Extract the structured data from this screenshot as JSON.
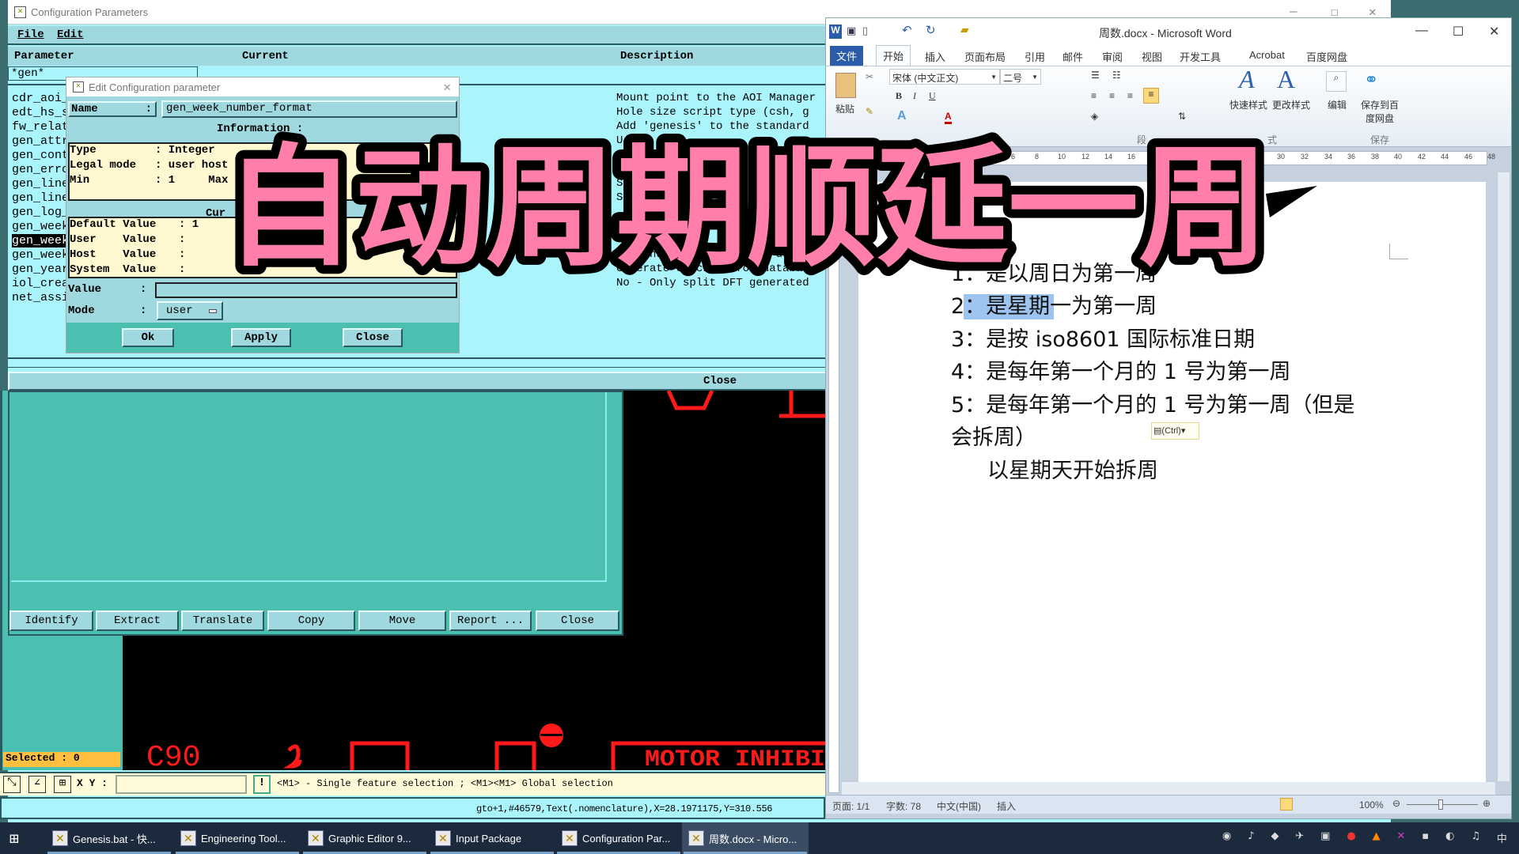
{
  "config_window": {
    "title": "Configuration Parameters",
    "menu": [
      "File",
      "Edit"
    ],
    "columns": [
      "Parameter",
      "Current",
      "Description"
    ],
    "filter": "*gen*",
    "parameters": [
      "cdr_aoi_",
      "edt_hs_s",
      "fw_relat",
      "gen_attr",
      "gen_cont",
      "gen_erro",
      "gen_line",
      "gen_line",
      "gen_log_",
      "gen_week",
      "gen_week",
      "gen_week",
      "gen_year",
      "iol_crea",
      "net_assi"
    ],
    "selected_index": 10,
    "descriptions": [
      "Mount point to the AOI Manager",
      "Hole size script type (csh, g",
      "Add 'genesis' to the standard",
      "U",
      "",
      "",
      "S",
      "S",
      "",
      "",
      "",
      "Year number 1 real with user",
      "Generate checksum for database",
      "No - Only split DFT generated",
      ""
    ],
    "close_label": "Close"
  },
  "edit_dialog": {
    "title": "Edit Configuration parameter",
    "name_label": "Name",
    "name_value": "gen_week_number_format",
    "information_label": "Information :",
    "info": [
      {
        "label": "Type",
        "value": ": Integer"
      },
      {
        "label": "Legal mode",
        "value": ": user host"
      },
      {
        "label": "Min",
        "value": ": 1     Max"
      }
    ],
    "current_label": "Cur",
    "values": [
      {
        "label": "Default Value",
        "value": ": 1"
      },
      {
        "label": "User    Value",
        "value": ":"
      },
      {
        "label": "Host    Value",
        "value": ":"
      },
      {
        "label": "System  Value",
        "value": ":"
      }
    ],
    "value_label": "Value",
    "value_input": "",
    "mode_label": "Mode",
    "mode_value": "user",
    "buttons": [
      "Ok",
      "Apply",
      "Close"
    ]
  },
  "graphic_panel": {
    "buttons": [
      "Identify",
      "Extract",
      "Translate",
      "Copy",
      "Move",
      "Report ...",
      "Close"
    ],
    "selected": "Selected : 0",
    "xy_label": "X Y :",
    "xy_value": "",
    "hint": "<M1> - Single feature selection ; <M1><M1> Global selection",
    "status": "gto+1,#46579,Text(.nomenclature),X=28.1971175,Y=310.556",
    "canvas_text": [
      "C90",
      "MOTOR INHIBI"
    ]
  },
  "word": {
    "title": "周数.docx - Microsoft Word",
    "tabs": [
      "文件",
      "开始",
      "插入",
      "页面布局",
      "引用",
      "邮件",
      "审阅",
      "视图",
      "开发工具",
      "Acrobat",
      "百度网盘"
    ],
    "active_tab": "开始",
    "font_name": "宋体 (中文正文)",
    "font_size": "二号",
    "ribbon_labels": {
      "paste": "粘贴",
      "quick_styles": "快速样式",
      "change_styles": "更改样式",
      "edit": "编辑",
      "save_baidu": "保存到百度网盘",
      "save_group": "保存",
      "para_group": "段",
      "style_group": "式"
    },
    "ruler": [
      "6",
      "8",
      "10",
      "12",
      "14",
      "16",
      "30",
      "32",
      "34",
      "36",
      "38",
      "40",
      "42",
      "44",
      "46",
      "48"
    ],
    "lines": [
      "1：是以周日为第一周",
      "2：是星期一为第一周",
      "3：是按 iso8601 国际标准日期",
      "4：是每年第一个月的 1 号为第一周",
      "5：是每年第一个月的 1 号为第一周（但是",
      "会拆周）",
      "以星期天开始拆周"
    ],
    "selected_text": "：是星期",
    "paste_option": "(Ctrl)",
    "status": {
      "page": "页面: 1/1",
      "words": "字数: 78",
      "lang": "中文(中国)",
      "mode": "插入",
      "zoom": "100%"
    }
  },
  "overlay_caption": "自动周期顺延一周",
  "taskbar": [
    "Genesis.bat - 快...",
    "Engineering Tool...",
    "Graphic Editor 9...",
    "Input Package",
    "Configuration Par...",
    "周数.docx - Micro..."
  ],
  "colors": {
    "motif_cyan": "#aaf4fc",
    "motif_teal": "#4cc0b0",
    "info_yellow": "#fff8d0",
    "caption_pink": "#ff7eaa",
    "canvas_red": "#ff1a1a"
  }
}
